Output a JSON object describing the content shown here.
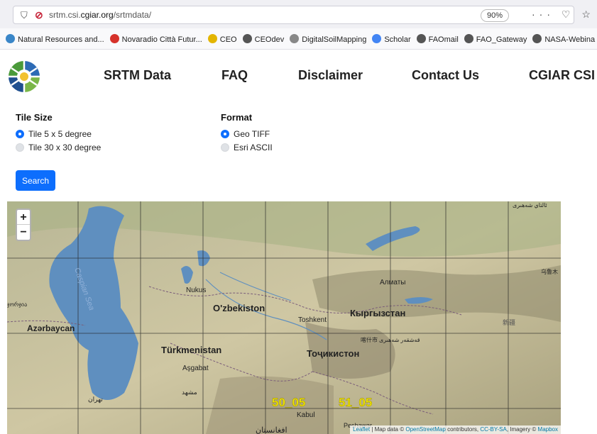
{
  "browser": {
    "url_prefix": "srtm.csi.",
    "url_domain": "cgiar.org",
    "url_path": "/srtmdata/",
    "zoom_level": "90%",
    "bookmarks": [
      {
        "label": "Natural Resources and...",
        "icon": "leaf-icon",
        "color": "#3a86c8"
      },
      {
        "label": "Novaradio Città Futur...",
        "icon": "radio-icon",
        "color": "#d6322b"
      },
      {
        "label": "CEO",
        "icon": "ceo-icon",
        "color": "#e3b500"
      },
      {
        "label": "CEOdev",
        "icon": "globe-icon",
        "color": "#555555"
      },
      {
        "label": "DigitalSoilMapping",
        "icon": "folder-icon",
        "color": "#888888"
      },
      {
        "label": "Scholar",
        "icon": "scholar-icon",
        "color": "#4285f4"
      },
      {
        "label": "FAOmail",
        "icon": "globe-icon",
        "color": "#555555"
      },
      {
        "label": "FAO_Gateway",
        "icon": "globe-icon",
        "color": "#555555"
      },
      {
        "label": "NASA-Webina",
        "icon": "globe-icon",
        "color": "#555555"
      }
    ]
  },
  "nav": {
    "items": [
      "SRTM Data",
      "FAQ",
      "Disclaimer",
      "Contact Us",
      "CGIAR CSI"
    ]
  },
  "form": {
    "tile_size": {
      "title": "Tile Size",
      "options": [
        {
          "label": "Tile 5 x 5 degree",
          "selected": true
        },
        {
          "label": "Tile 30 x 30 degree",
          "selected": false
        }
      ]
    },
    "format": {
      "title": "Format",
      "options": [
        {
          "label": "Geo TIFF",
          "selected": true
        },
        {
          "label": "Esri ASCII",
          "selected": false
        }
      ]
    },
    "search_label": "Search"
  },
  "map": {
    "zoom_in": "+",
    "zoom_out": "−",
    "place_labels": [
      "Nukus",
      "O'zbekiston",
      "Toshkent",
      "Кыргызстан",
      "Алматы",
      "Azərbaycan",
      "Türkmenistan",
      "Aşgabat",
      "Тоҷикистон",
      "Kabul",
      "Peshawar",
      "Caspian Sea",
      "新疆",
      "مشهد",
      "تهران",
      "افغانستان",
      "喀什市",
      "乌鲁木",
      "ئالتاي شەھىرى",
      "قەشقەر شەھىرى",
      "ჯორჯია"
    ],
    "tiles": [
      "50_05",
      "51_05"
    ],
    "attribution": {
      "leaflet": "Leaflet",
      "map_data": "| Map data ©",
      "osm": "OpenStreetMap",
      "contributors": "contributors,",
      "license": "CC-BY-SA",
      "imagery": ", Imagery ©",
      "mapbox": "Mapbox"
    },
    "colors": {
      "tile_label": "#f2e600",
      "grid": "#222222",
      "water": "#5f8fbf"
    }
  }
}
